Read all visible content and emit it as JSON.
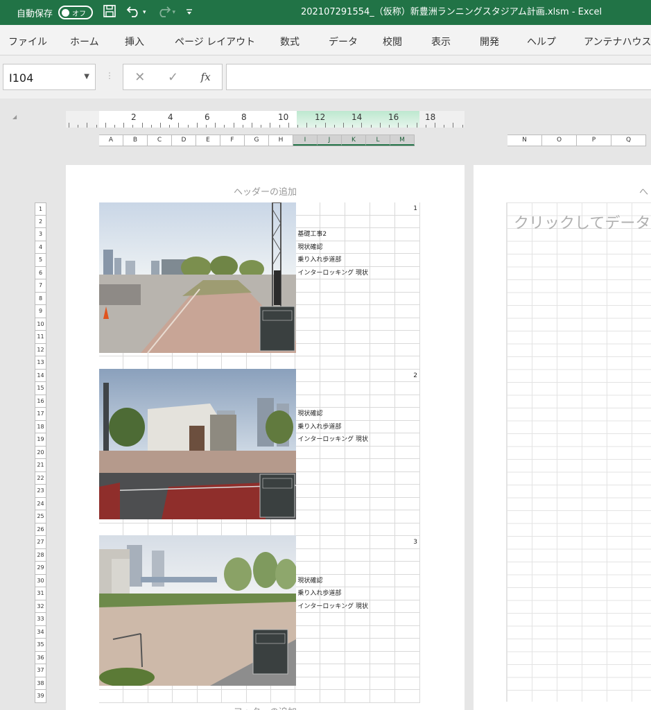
{
  "titlebar": {
    "autosave_label": "自動保存",
    "autosave_state": "オフ",
    "title": "202107291554_（仮称）新豊洲ランニングスタジアム計画.xlsm  -  Excel"
  },
  "ribbon_tabs": [
    "ファイル",
    "ホーム",
    "挿入",
    "ページ レイアウト",
    "数式",
    "データ",
    "校閲",
    "表示",
    "開発",
    "ヘルプ",
    "アンテナハウス"
  ],
  "formula_bar": {
    "name_box": "I104",
    "cancel": "✕",
    "enter": "✓",
    "fx": "fx",
    "value": ""
  },
  "ruler_numbers": [
    "2",
    "4",
    "6",
    "8",
    "10",
    "12",
    "14",
    "16",
    "18"
  ],
  "columns_page1": [
    "A",
    "B",
    "C",
    "D",
    "E",
    "F",
    "G",
    "H",
    "I",
    "J",
    "K",
    "L",
    "M"
  ],
  "columns_page2": [
    "N",
    "O",
    "P",
    "Q"
  ],
  "page1": {
    "header_hint": "ヘッダーの追加",
    "footer_hint": "フッターの追加",
    "rows": [
      "1",
      "2",
      "3",
      "4",
      "5",
      "6",
      "7",
      "8",
      "9",
      "10",
      "11",
      "12",
      "13",
      "14",
      "15",
      "16",
      "17",
      "18",
      "19",
      "20",
      "21",
      "22",
      "23",
      "24",
      "25",
      "26",
      "27",
      "28",
      "29",
      "30",
      "31",
      "32",
      "33",
      "34",
      "35",
      "36",
      "37",
      "38",
      "39"
    ],
    "entries": [
      {
        "number": "1",
        "title": "基礎工事2",
        "lines": [
          "現状確認",
          "乗り入れ歩道部",
          "インターロッキング 現状"
        ]
      },
      {
        "number": "2",
        "lines": [
          "現状確認",
          "乗り入れ歩道部",
          "インターロッキング 現状"
        ]
      },
      {
        "number": "3",
        "lines": [
          "現状確認",
          "乗り入れ歩道部",
          "インターロッキング 現状"
        ]
      }
    ]
  },
  "page2": {
    "header_hint": "へ",
    "click_hint": "クリックしてデータを"
  }
}
